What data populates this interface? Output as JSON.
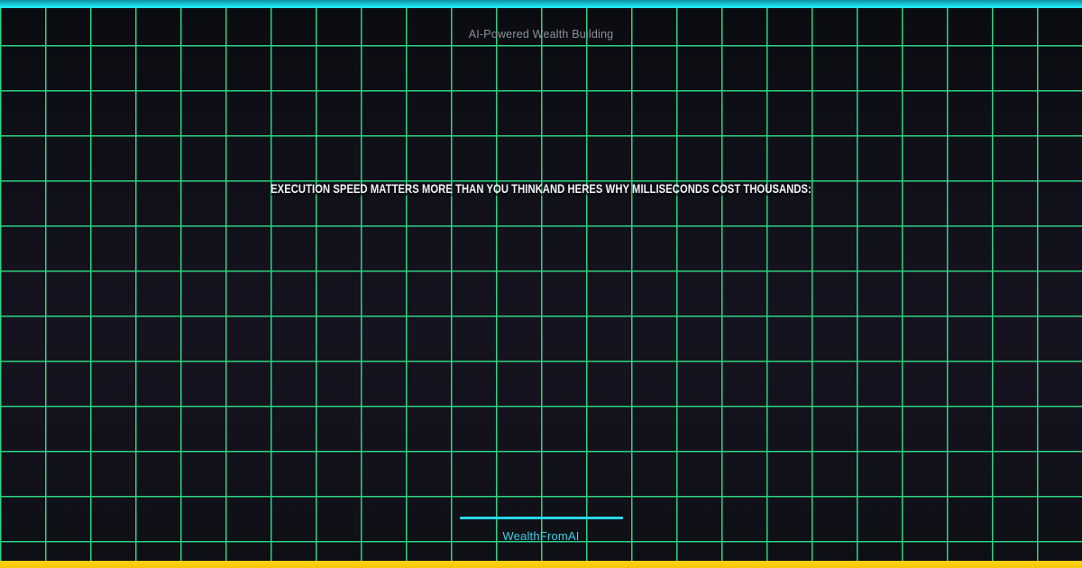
{
  "card": {
    "eyebrow": "AI-Powered Wealth Building",
    "headline": "EXECUTION SPEED MATTERS MORE THAN YOU THINKAND HERES WHY MILLISECONDS COST THOUSANDS:",
    "brand": "WealthFromAI"
  },
  "colors": {
    "background_top": "#0a0c11",
    "background_mid": "#15131f",
    "background_bot": "#0e0f15",
    "grid_line": "#2de58a",
    "top_bar_dark": "#0a90a4",
    "top_bar_bright": "#22e7f4",
    "bottom_bar": "#f8c90a",
    "eyebrow_text": "#8b9099",
    "headline_text": "#f3f4f6",
    "brand_text": "#38d2e3",
    "divider": "#26d8ea"
  }
}
